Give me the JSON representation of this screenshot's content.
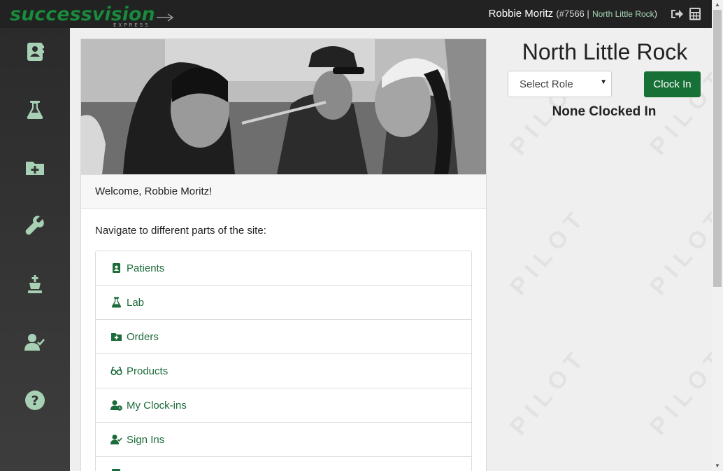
{
  "header": {
    "logo_text": "successvision",
    "logo_sub": "EXPRESS",
    "user_name": "Robbie Moritz",
    "user_id": "(#7566 |",
    "user_location": "North Little Rock",
    "user_close": ")"
  },
  "sidebar": {
    "items": [
      {
        "icon": "patients-icon"
      },
      {
        "icon": "lab-flask-icon"
      },
      {
        "icon": "orders-folder-icon"
      },
      {
        "icon": "wrench-icon"
      },
      {
        "icon": "chess-king-icon"
      },
      {
        "icon": "user-check-icon"
      },
      {
        "icon": "help-circle-icon"
      }
    ]
  },
  "main": {
    "welcome": "Welcome, Robbie Moritz!",
    "nav_intro": "Navigate to different parts of the site:",
    "nav_items": [
      {
        "label": "Patients",
        "icon": "patients-icon"
      },
      {
        "label": "Lab",
        "icon": "flask-icon"
      },
      {
        "label": "Orders",
        "icon": "folder-plus-icon"
      },
      {
        "label": "Products",
        "icon": "glasses-icon"
      },
      {
        "label": "My Clock-ins",
        "icon": "user-clock-icon"
      },
      {
        "label": "Sign Ins",
        "icon": "user-check-icon"
      }
    ]
  },
  "right": {
    "location_title": "North Little Rock",
    "role_select": "Select Role",
    "clock_in": "Clock In",
    "status": "None Clocked In",
    "watermark": "PILOT"
  },
  "colors": {
    "accent": "#177035",
    "link": "#1c6b3a",
    "topbar": "#222222"
  }
}
